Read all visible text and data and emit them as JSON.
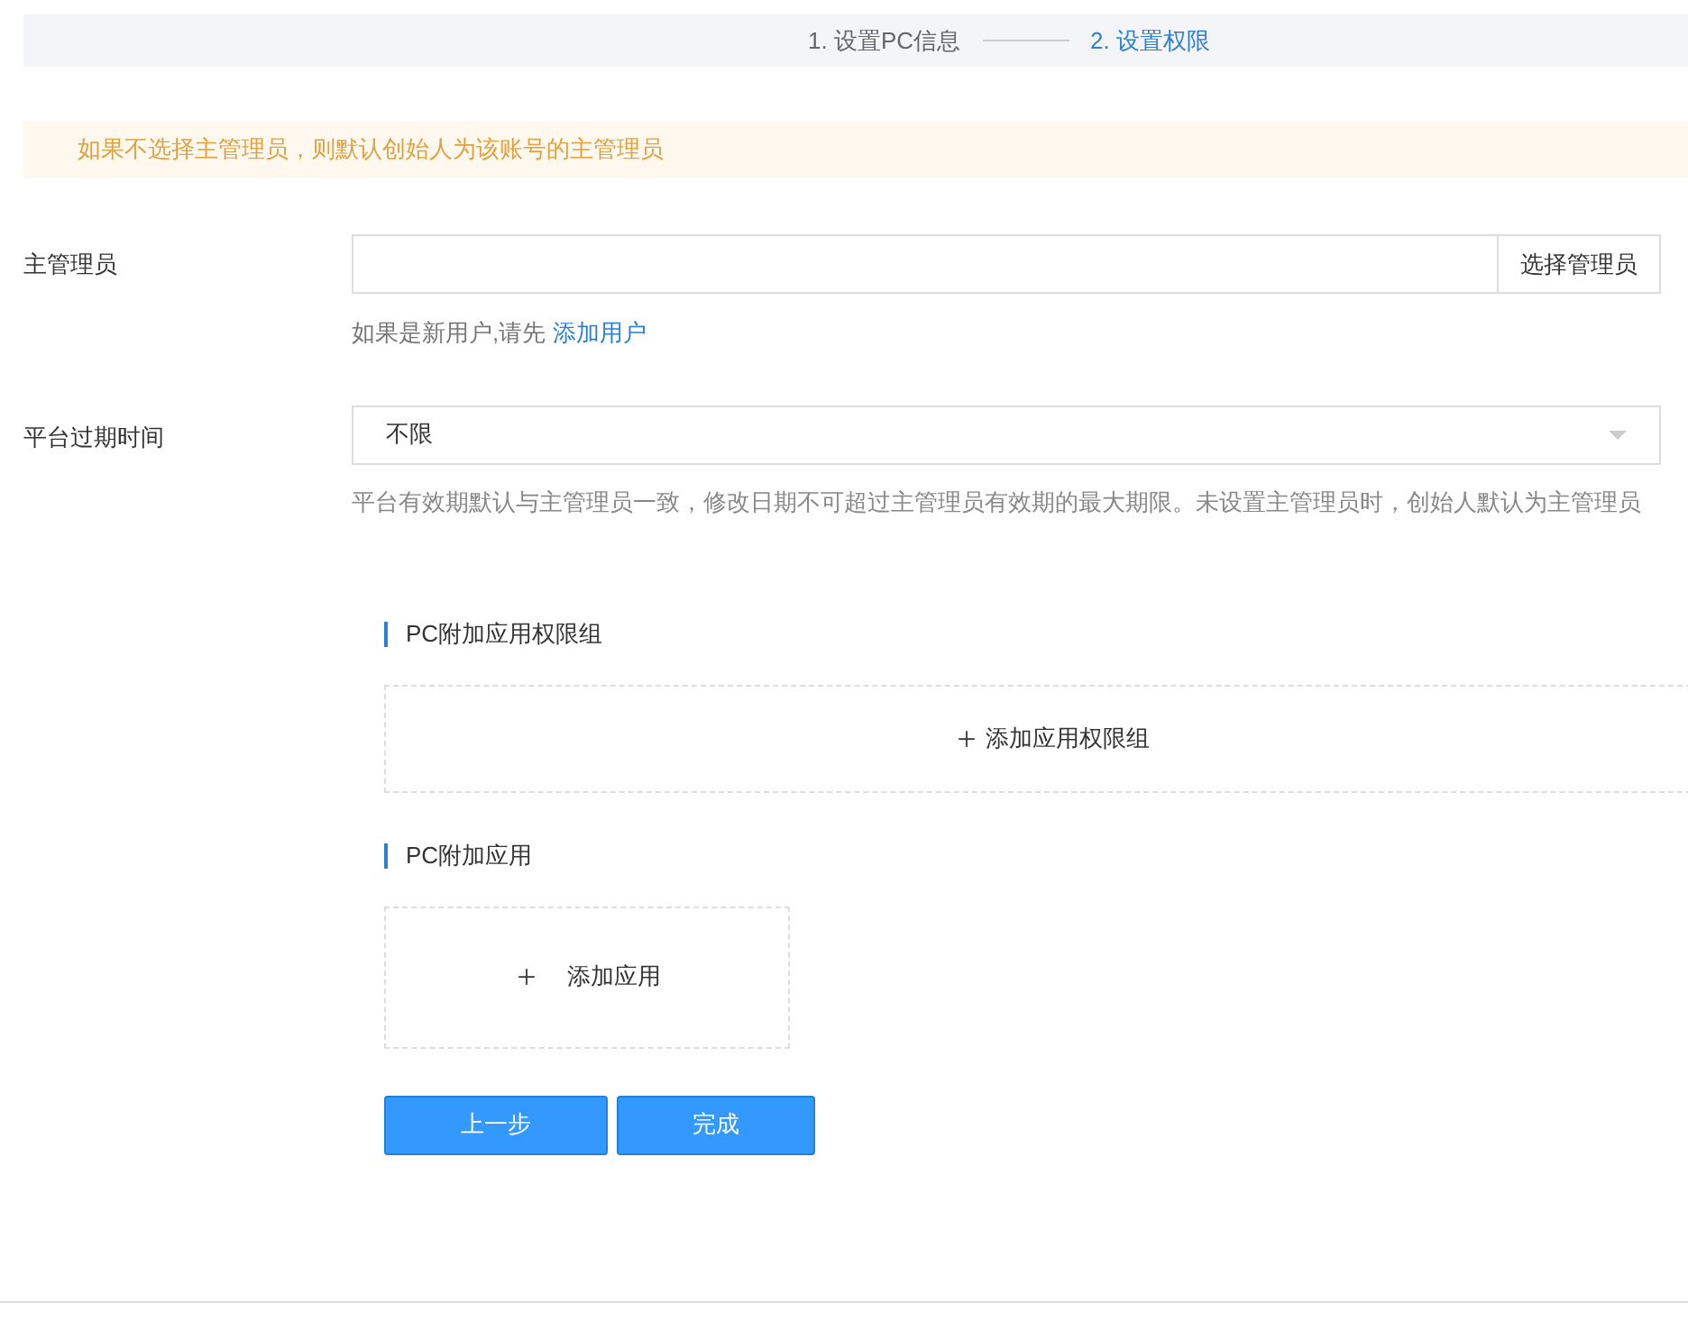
{
  "steps": [
    {
      "label": "1. 设置PC信息",
      "selected": false
    },
    {
      "label": "2. 设置权限",
      "selected": true
    }
  ],
  "notice": "如果不选择主管理员，则默认创始人为该账号的主管理员",
  "admin_field": {
    "label": "主管理员",
    "button": "选择管理员",
    "hint": "如果是新用户,请先",
    "hint_link": "添加用户"
  },
  "expiry_field": {
    "label": "平台过期时间",
    "value": "不限",
    "description": "平台有效期默认与主管理员一致，修改日期不可超过主管理员有效期的最大期限。未设置主管理员时，创始人默认为主管理员"
  },
  "sections": [
    {
      "title": "PC附加应用权限组",
      "add_label": "添加应用权限组",
      "kind": "wide"
    },
    {
      "title": "PC附加应用",
      "add_label": "添加应用",
      "kind": "narrow"
    }
  ],
  "buttons": [
    "上一步",
    "完成"
  ]
}
